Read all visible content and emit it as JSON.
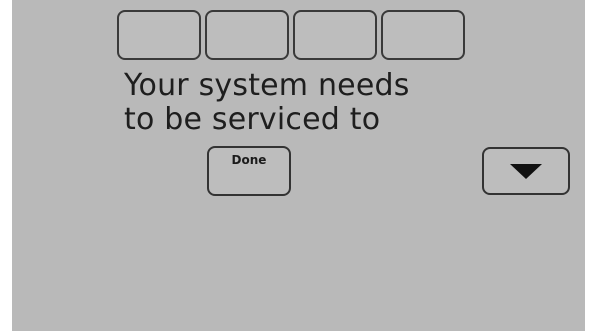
{
  "screen": {
    "digit_slots": [
      "",
      "",
      "",
      ""
    ],
    "message": {
      "line1": "Your system needs",
      "line2": "to be serviced to"
    },
    "done_label": "Done",
    "down_arrow_icon": "triangle-down-icon"
  }
}
